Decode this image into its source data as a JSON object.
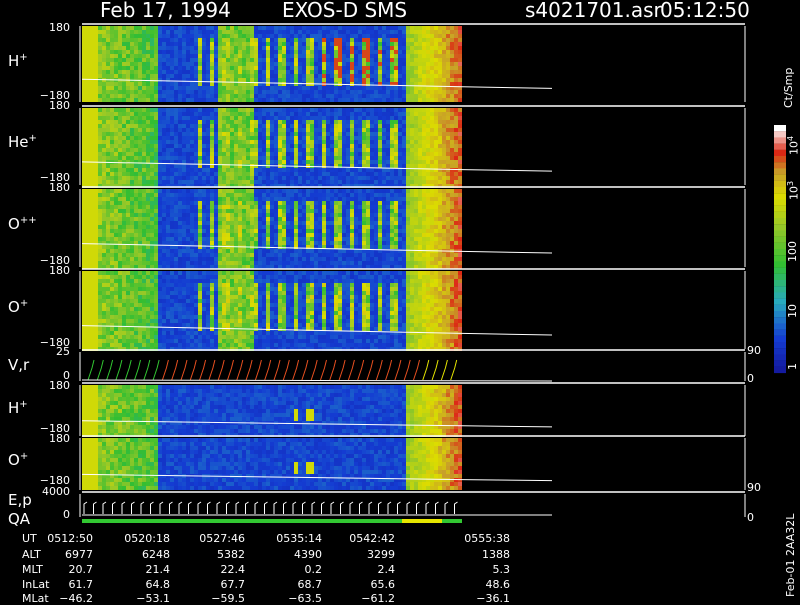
{
  "header": {
    "date": "Feb 17, 1994",
    "instrument": "EXOS-D SMS",
    "file": "s4021701.asr",
    "time": "05:12:50"
  },
  "panels": [
    {
      "label_main": "H",
      "label_sup": "+",
      "top": "180",
      "bottom": "−180"
    },
    {
      "label_main": "He",
      "label_sup": "+",
      "top": "180",
      "bottom": "−180"
    },
    {
      "label_main": "O",
      "label_sup": "++",
      "top": "180",
      "bottom": "−180"
    },
    {
      "label_main": "O",
      "label_sup": "+",
      "top": "180",
      "bottom": "−180"
    },
    {
      "label_main": "V,r",
      "label_sup": "",
      "top": "25",
      "bottom": "0",
      "right_top": "90",
      "right_bottom": "0"
    },
    {
      "label_main": "H",
      "label_sup": "+",
      "top": "180",
      "bottom": "−180"
    },
    {
      "label_main": "O",
      "label_sup": "+",
      "top": "180",
      "bottom": "−180"
    },
    {
      "label_main": "E,p",
      "label_sup": "",
      "top": "4000",
      "bottom": "0",
      "right_top": "90",
      "right_bottom": "0"
    }
  ],
  "qa_label": "QA",
  "colorbar": {
    "unit": "Ct/Smp",
    "ticks": [
      {
        "base": "10",
        "exp": "4"
      },
      {
        "base": "10",
        "exp": "3"
      },
      {
        "base": "100",
        "exp": ""
      },
      {
        "base": "10",
        "exp": ""
      },
      {
        "base": "1",
        "exp": ""
      }
    ]
  },
  "footer_note": "Feb-01 2AA32L",
  "ephemeris": {
    "row_labels": [
      "UT",
      "ALT",
      "MLT",
      "InLat",
      "MLat"
    ],
    "columns": [
      {
        "UT": "0512:50",
        "ALT": "6977",
        "MLT": "20.7",
        "InLat": "61.7",
        "MLat": "−46.2"
      },
      {
        "UT": "0520:18",
        "ALT": "6248",
        "MLT": "21.4",
        "InLat": "64.8",
        "MLat": "−53.1"
      },
      {
        "UT": "0527:46",
        "ALT": "5382",
        "MLT": "22.4",
        "InLat": "67.7",
        "MLat": "−59.5"
      },
      {
        "UT": "0535:14",
        "ALT": "4390",
        "MLT": "0.2",
        "InLat": "68.7",
        "MLat": "−63.5"
      },
      {
        "UT": "0542:42",
        "ALT": "3299",
        "MLT": "2.4",
        "InLat": "65.6",
        "MLat": "−61.2"
      },
      {
        "UT": "0555:38",
        "ALT": "1388",
        "MLT": "5.3",
        "InLat": "48.6",
        "MLat": "−36.1"
      }
    ]
  },
  "chart_data": {
    "type": "heatmap",
    "title": "Feb 17, 1994   EXOS-D SMS",
    "x_ticks": [
      "0512:50",
      "0520:18",
      "0527:46",
      "0535:14",
      "0542:42",
      "0555:38"
    ],
    "panels": [
      "H+",
      "He+",
      "O++",
      "O+",
      "V,r",
      "H+",
      "O+",
      "E,p"
    ],
    "ylim_pitch": [
      -180,
      180
    ],
    "ylim_vr": [
      0,
      25
    ],
    "ylim_ep": [
      0,
      4000
    ],
    "colorbar_range": [
      1,
      10000
    ],
    "colorbar_scale": "log",
    "colors": {
      "low": "#1a1aa6",
      "mid": "#32c832",
      "high": "#e6e600",
      "max": "#dc1414",
      "cyan": "#28c8c8"
    }
  }
}
